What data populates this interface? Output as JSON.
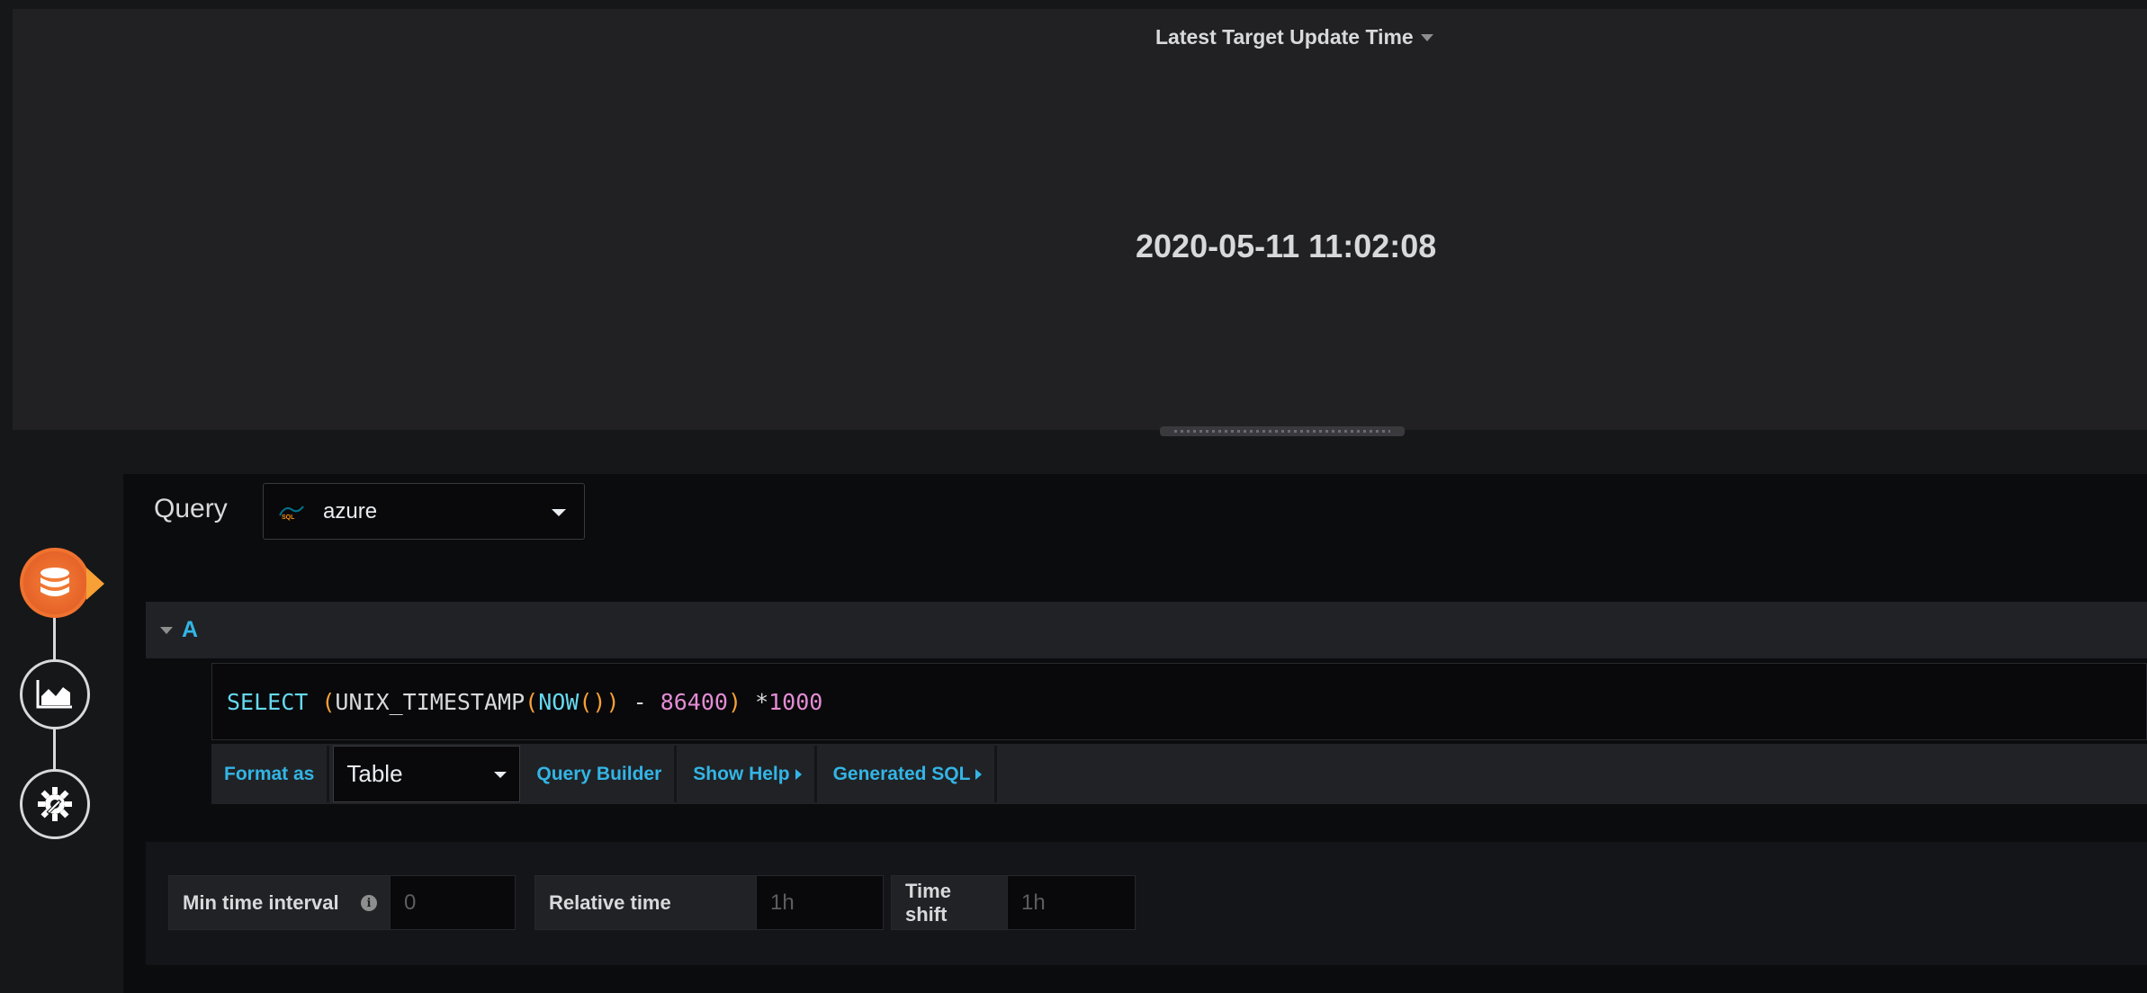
{
  "panel": {
    "title": "Latest Target Update Time",
    "value": "2020-05-11 11:02:08"
  },
  "rail": {
    "items": [
      {
        "name": "queries",
        "icon": "database-icon",
        "active": true
      },
      {
        "name": "visualization",
        "icon": "area-chart-icon",
        "active": false
      },
      {
        "name": "general",
        "icon": "gear-wrench-icon",
        "active": false
      }
    ]
  },
  "editor": {
    "query_label": "Query",
    "datasource": {
      "name": "azure",
      "logo": "mysql-logo"
    },
    "query": {
      "ref_id": "A",
      "sql_tokens": {
        "select": "SELECT",
        "open1": " (",
        "func1": "UNIX_TIMESTAMP",
        "open2": "(",
        "func2": "NOW",
        "parens": "()",
        "close2": ")",
        "minus": " - ",
        "num1": "86400",
        "close1": ")",
        "mult": " *",
        "num2": "1000"
      }
    },
    "toolbar": {
      "format_as_label": "Format as",
      "format_value": "Table",
      "query_builder": "Query Builder",
      "show_help": "Show Help",
      "generated_sql": "Generated SQL"
    },
    "options": {
      "min_interval_label": "Min time interval",
      "min_interval_placeholder": "0",
      "relative_time_label": "Relative time",
      "relative_time_placeholder": "1h",
      "time_shift_label": "Time shift",
      "time_shift_placeholder": "1h"
    }
  },
  "colors": {
    "accent_blue": "#33b5e5",
    "accent_orange": "#f0722f",
    "sql_keyword": "#66d9ef",
    "sql_number": "#e48cd5"
  }
}
